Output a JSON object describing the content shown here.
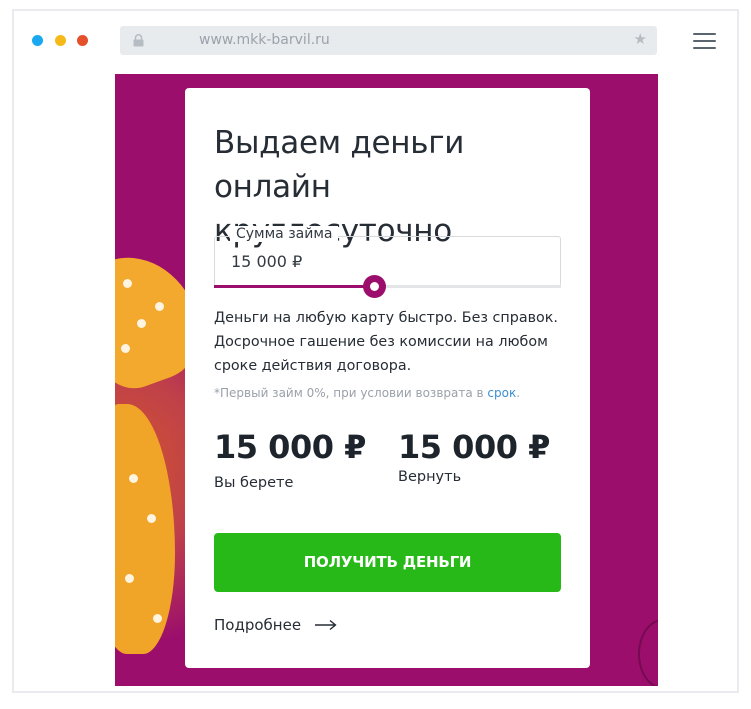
{
  "browser": {
    "url": "www.mkk-barvil.ru",
    "icons": [
      "lock-icon",
      "star-icon",
      "menu-icon"
    ]
  },
  "colors": {
    "hero_bg": "#9c0e6c",
    "accent": "#9c0e6c",
    "cta_bg": "#27b917",
    "link": "#3b8ed0"
  },
  "card": {
    "headline": "Выдаем деньги онлайн круглосуточно",
    "amount_label": "Сумма займа",
    "amount_value": "15 000 ₽",
    "slider_fraction": 0.46,
    "description": "Деньги на любую карту быстро. Без справок. Досрочное гашение без комиссии на любом сроке действия договора.",
    "footnote_text": "*Первый займ 0%, при условии возврата в ",
    "footnote_link": "срок",
    "footnote_end": ".",
    "take_amount": "15 000 ₽",
    "take_label": "Вы берете",
    "return_amount": "15 000 ₽",
    "return_label": "Вернуть",
    "cta_label": "ПОЛУЧИТЬ ДЕНЬГИ",
    "more_label": "Подробнее"
  }
}
